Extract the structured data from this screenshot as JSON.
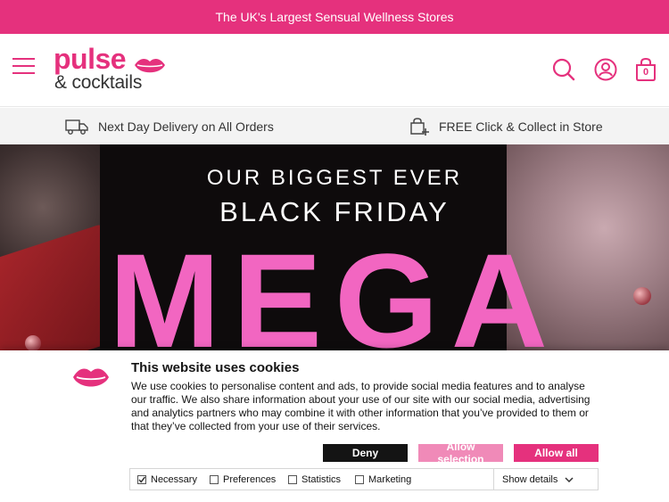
{
  "topbar": {
    "text": "The UK's Largest Sensual Wellness Stores"
  },
  "header": {
    "logo_line1": "pulse",
    "logo_line2": "& cocktails",
    "basket_count": "0",
    "brand_color": "#e5317d",
    "icons": [
      "menu-icon",
      "search-icon",
      "account-icon",
      "basket-icon"
    ]
  },
  "usp": {
    "delivery": "Next Day Delivery on All Orders",
    "collect": "FREE Click & Collect in Store"
  },
  "hero": {
    "line1": "OUR BIGGEST EVER",
    "line2": "BLACK FRIDAY",
    "line3": "MEGA",
    "accent_color": "#f266c1"
  },
  "cookie": {
    "title": "This website uses cookies",
    "body": "We use cookies to personalise content and ads, to provide social media features and to analyse our traffic. We also share information about your use of our site with our social media, advertising and analytics partners who may combine it with other information that you’ve provided to them or that they’ve collected from your use of their services.",
    "deny": "Deny",
    "allow_selection": "Allow selection",
    "allow_all": "Allow all",
    "options": [
      {
        "label": "Necessary",
        "checked": true
      },
      {
        "label": "Preferences",
        "checked": false
      },
      {
        "label": "Statistics",
        "checked": false
      },
      {
        "label": "Marketing",
        "checked": false
      }
    ],
    "show_details": "Show details"
  }
}
